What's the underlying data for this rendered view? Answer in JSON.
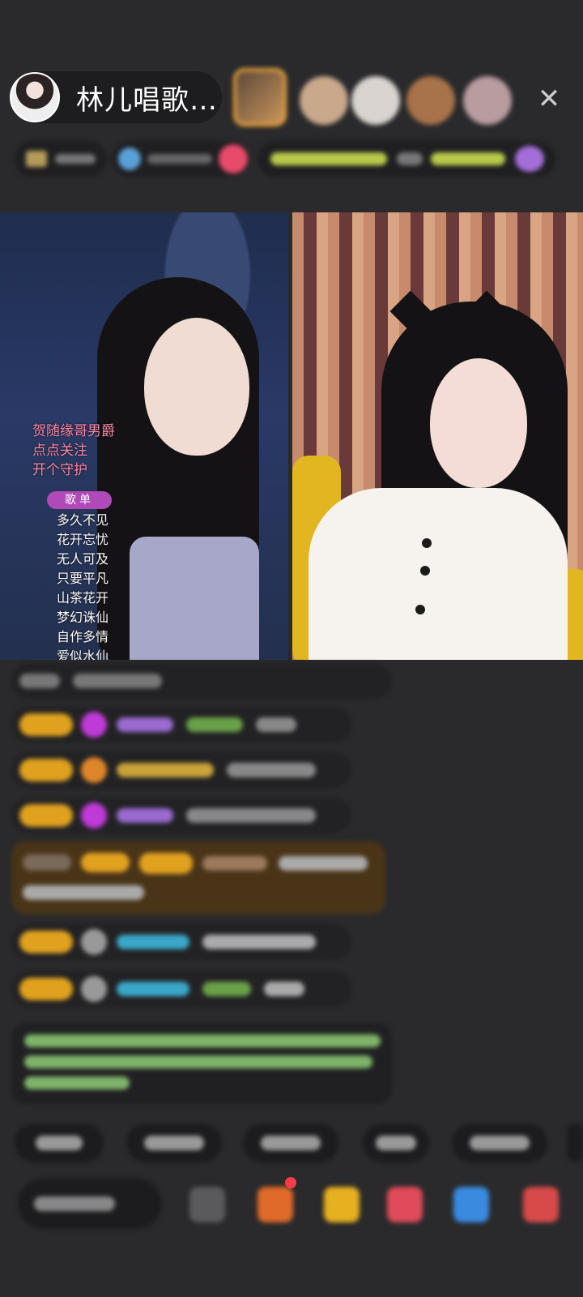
{
  "header": {
    "host_name": "林儿唱歌…",
    "close_glyph": "✕"
  },
  "stream": {
    "overlay_lines": [
      "贺随缘哥男爵",
      "点点关注",
      "开个守护"
    ],
    "overlay_color": "#ff8aa8",
    "song_list_label": "歌单",
    "songs": [
      "多久不见",
      "花开忘忧",
      "无人可及",
      "只要平凡",
      "山茶花开",
      "梦幻诛仙",
      "自作多情",
      "爱似水仙"
    ]
  },
  "colors": {
    "background": "#2a2a2c",
    "level_badge": "#e0a11f",
    "notice_text": "#7fb36a"
  }
}
